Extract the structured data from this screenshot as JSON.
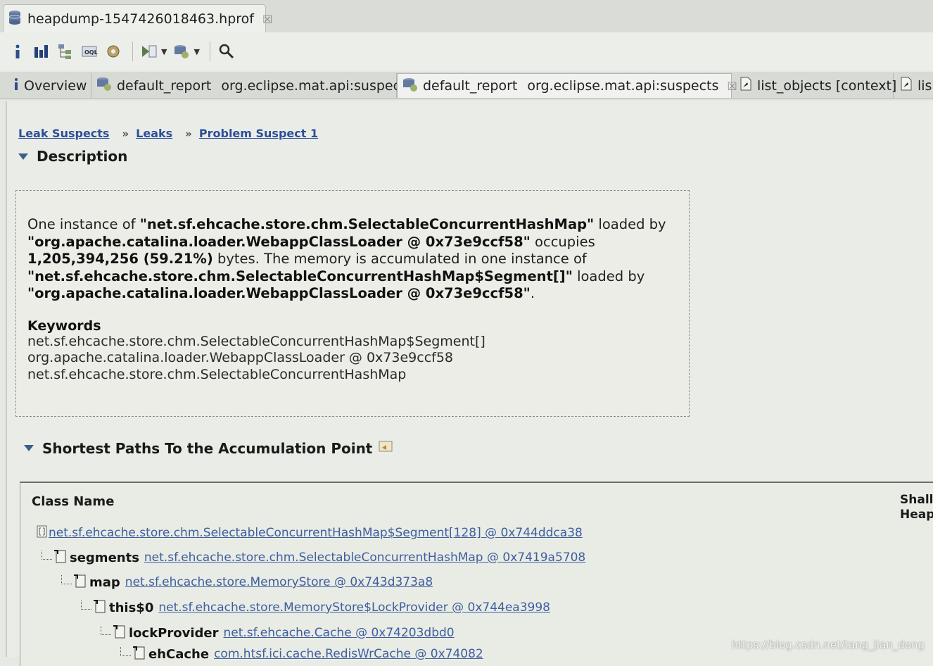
{
  "editor": {
    "title": "heapdump-1547426018463.hprof",
    "close_glyph": "☒"
  },
  "toolbar": {
    "buttons": [
      "info-icon",
      "histogram-icon",
      "dominator-tree-icon",
      "oql-icon",
      "thread-overview-icon",
      "run-expert-icon",
      "reports-icon",
      "search-icon"
    ]
  },
  "tabs": [
    {
      "label": "Overview"
    },
    {
      "label": "default_report",
      "suffix": "org.eclipse.mat.api:suspects"
    },
    {
      "label": "default_report",
      "suffix": "org.eclipse.mat.api:suspects"
    },
    {
      "label": "list_objects [context]"
    },
    {
      "label": "lis"
    }
  ],
  "breadcrumb": {
    "items": [
      "Leak Suspects",
      "Leaks",
      "Problem Suspect 1"
    ],
    "separator": "»"
  },
  "description": {
    "heading": "Description",
    "p1": "One instance of ",
    "cls1": "\"net.sf.ehcache.store.chm.SelectableConcurrentHashMap\"",
    "p2": " loaded by ",
    "loader1": "\"org.apache.catalina.loader.WebappClassLoader @ 0x73e9ccf58\"",
    "p3": " occupies ",
    "size": "1,205,394,256 (59.21%)",
    "p4": " bytes. The memory is accumulated in one instance of ",
    "cls2": "\"net.sf.ehcache.store.chm.SelectableConcurrentHashMap$Segment[]\"",
    "p5": " loaded by ",
    "loader2": "\"org.apache.catalina.loader.WebappClassLoader @ 0x73e9ccf58\"",
    "p6": ".",
    "keywords_title": "Keywords",
    "keywords": [
      "net.sf.ehcache.store.chm.SelectableConcurrentHashMap$Segment[]",
      "org.apache.catalina.loader.WebappClassLoader @ 0x73e9ccf58",
      "net.sf.ehcache.store.chm.SelectableConcurrentHashMap"
    ]
  },
  "paths": {
    "heading": "Shortest Paths To the Accumulation Point",
    "col_class": "Class Name",
    "col_shallow_1": "Shall",
    "col_shallow_2": "Heap",
    "rows": [
      {
        "field": "",
        "object": "net.sf.ehcache.store.chm.SelectableConcurrentHashMap$Segment[128] @ 0x744ddca38"
      },
      {
        "field": "segments",
        "object": "net.sf.ehcache.store.chm.SelectableConcurrentHashMap @ 0x7419a5708"
      },
      {
        "field": "map",
        "object": "net.sf.ehcache.store.MemoryStore @ 0x743d373a8"
      },
      {
        "field": "this$0",
        "object": "net.sf.ehcache.store.MemoryStore$LockProvider @ 0x744ea3998"
      },
      {
        "field": "lockProvider",
        "object": "net.sf.ehcache.Cache @ 0x74203dbd0"
      },
      {
        "field": "ehCache",
        "object": "com.htsf.ici.cache.RedisWrCache @ 0x74082"
      }
    ]
  },
  "watermark": "https://blog.csdn.net/tang_jian_dong",
  "colors": {
    "link": "#3d5f9e",
    "crumb": "#2c4f9a",
    "triangle": "#3c5e8a"
  }
}
